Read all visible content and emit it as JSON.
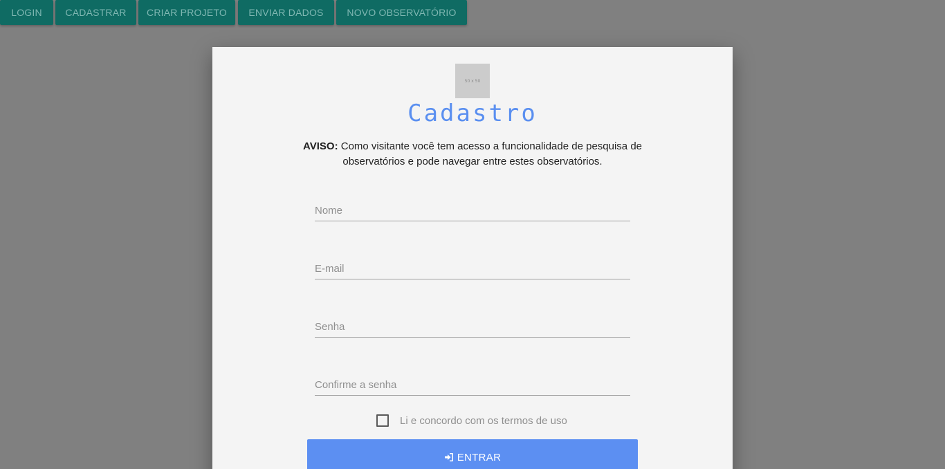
{
  "nav": {
    "items": [
      {
        "label": "LOGIN"
      },
      {
        "label": "CADASTRAR"
      },
      {
        "label": "CRIAR PROJETO"
      },
      {
        "label": "ENVIAR DADOS"
      },
      {
        "label": "NOVO OBSERVATÓRIO"
      }
    ]
  },
  "modal": {
    "logo_text": "50 x 50",
    "title": "Cadastro",
    "notice_label": "AVISO:",
    "notice_text": "Como visitante você tem acesso a funcionalidade de pesquisa de observatórios e pode navegar entre estes observatórios.",
    "fields": {
      "name": {
        "placeholder": "Nome",
        "value": ""
      },
      "email": {
        "placeholder": "E-mail",
        "value": ""
      },
      "password": {
        "placeholder": "Senha",
        "value": ""
      },
      "confirm": {
        "placeholder": "Confirme a senha",
        "value": ""
      }
    },
    "terms_label": "Li e concordo com os termos de uso",
    "terms_checked": false,
    "submit_icon": "sign-in-icon",
    "submit_label": "ENTRAR"
  },
  "colors": {
    "nav_bg": "#0f6b63",
    "accent": "#5c8ff2",
    "overlay": "#808080"
  }
}
